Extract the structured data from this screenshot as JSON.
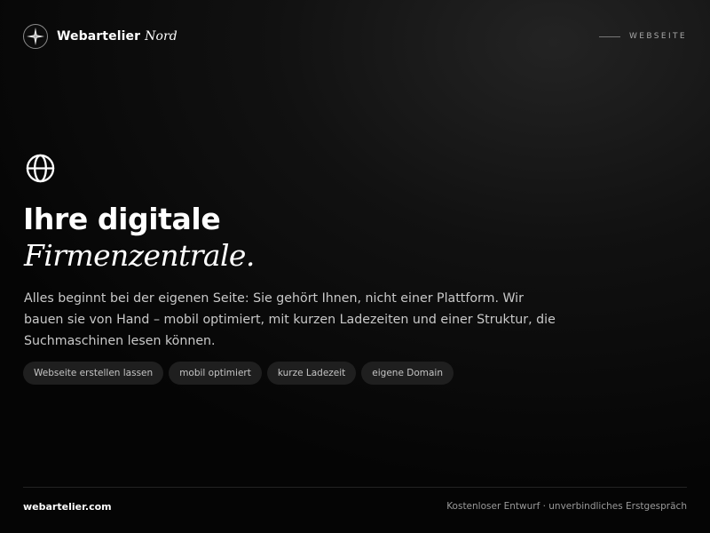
{
  "header": {
    "brand_name": "Webartelier",
    "brand_accent": "Nord",
    "brand_logo_icon": "compass-star-icon",
    "section_label": "WEBSEITE"
  },
  "hero": {
    "icon": "globe-icon",
    "title": "Ihre digitale",
    "title_accent": "Firmenzentrale.",
    "description": "Alles beginnt bei der eigenen Seite: Sie gehört Ihnen, nicht einer Plattform. Wir bauen sie von Hand – mobil optimiert, mit kurzen Ladezeiten und einer Struktur, die Suchmaschinen lesen können."
  },
  "tags": [
    "Webseite erstellen lassen",
    "mobil optimiert",
    "kurze Ladezeit",
    "eigene Domain"
  ],
  "footer": {
    "domain": "webartelier.com",
    "note": "Kostenloser Entwurf · unverbindliches Erstgespräch"
  },
  "colors": {
    "background": "#050505",
    "text": "#ffffff",
    "muted": "#c9c9c9",
    "tag_background": "#1f1f1f"
  }
}
